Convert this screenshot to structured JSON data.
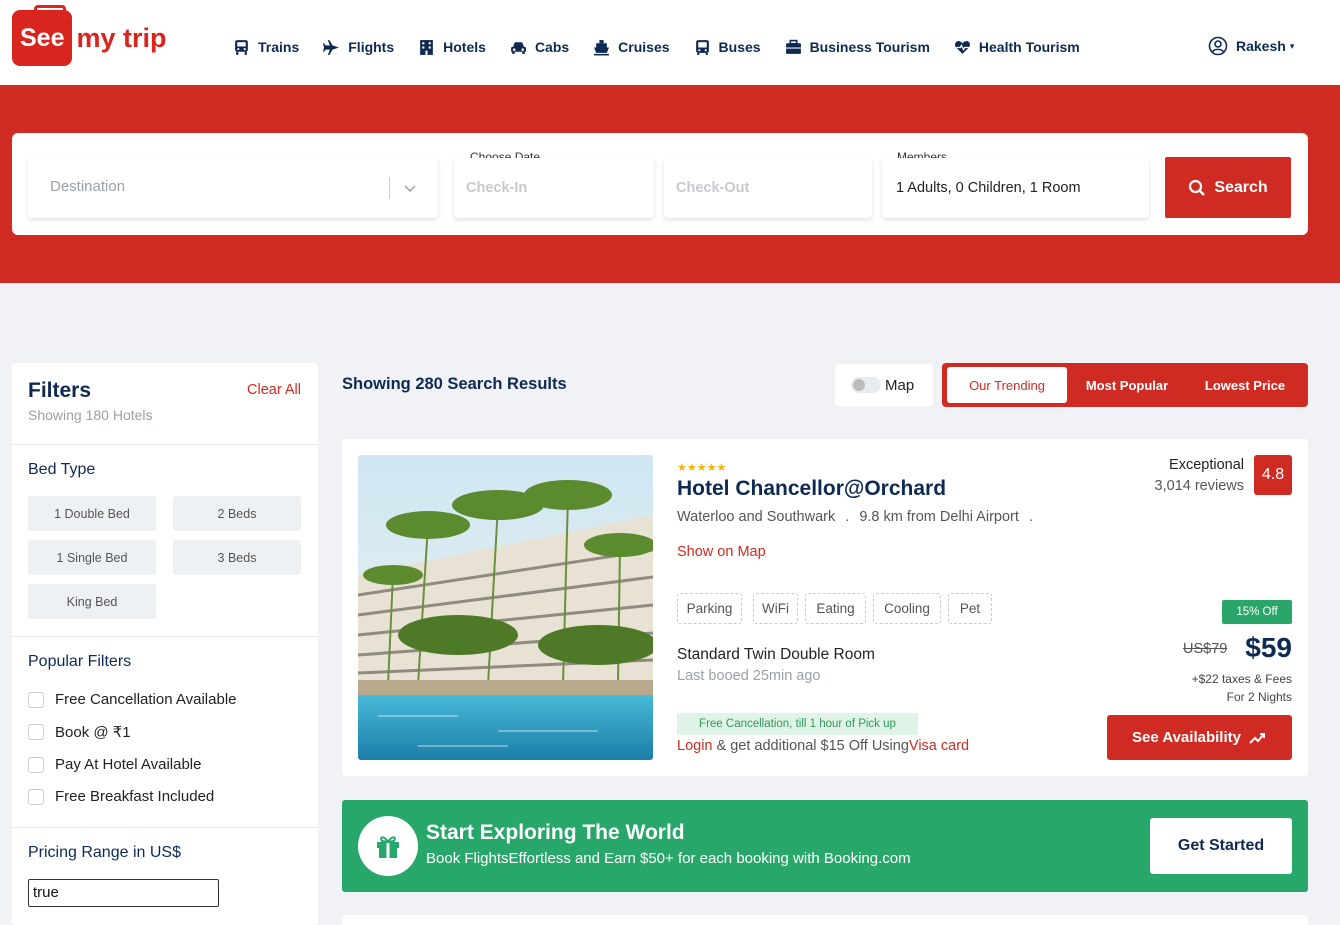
{
  "brand": {
    "logo_box": "See",
    "logo_rest": "my trip",
    "red": "#d02b23",
    "navy": "#0f2a52",
    "green": "#27a86a"
  },
  "nav": [
    {
      "label": "Trains",
      "icon": "train-icon"
    },
    {
      "label": "Flights",
      "icon": "plane-icon"
    },
    {
      "label": "Hotels",
      "icon": "hotel-icon"
    },
    {
      "label": "Cabs",
      "icon": "car-icon"
    },
    {
      "label": "Cruises",
      "icon": "ship-icon"
    },
    {
      "label": "Buses",
      "icon": "bus-icon"
    },
    {
      "label": "Business Tourism",
      "icon": "briefcase-icon"
    },
    {
      "label": "Health Tourism",
      "icon": "heart-pulse-icon"
    }
  ],
  "user": {
    "name": "Rakesh"
  },
  "search": {
    "destination_placeholder": "Destination",
    "date_label": "Choose Date",
    "checkin_placeholder": "Check-In",
    "checkout_placeholder": "Check-Out",
    "members_label": "Members",
    "members_value": "1 Adults, 0 Children, 1 Room",
    "button": "Search"
  },
  "filters": {
    "title": "Filters",
    "subtitle": "Showing 180 Hotels",
    "clear": "Clear All",
    "bed_type_title": "Bed Type",
    "beds": [
      "1 Double Bed",
      "2 Beds",
      "1 Single Bed",
      "3 Beds",
      "King Bed"
    ],
    "popular_title": "Popular Filters",
    "popular": [
      "Free Cancellation Available",
      "Book @ ₹1",
      "Pay At Hotel Available",
      "Free Breakfast Included"
    ],
    "pricing_title": "Pricing Range in US$",
    "pricing_value": "true"
  },
  "results": {
    "title": "Showing 280 Search Results",
    "map_label": "Map",
    "sort": [
      "Our Trending",
      "Most Popular",
      "Lowest Price"
    ]
  },
  "hotel": {
    "stars": "★★★★★",
    "name": "Hotel Chancellor@Orchard",
    "area": "Waterloo and Southwark",
    "distance": "9.8 km from Delhi Airport",
    "show_map": "Show on Map",
    "amenities": [
      "Parking",
      "WiFi",
      "Eating",
      "Cooling",
      "Pet"
    ],
    "room": "Standard Twin Double Room",
    "booked": "Last booed 25min ago",
    "free_cancel": "Free Cancellation, till 1 hour of Pick up",
    "login": "Login",
    "login_mid": " & get additional $15 Off Using",
    "login_card": "Visa card",
    "rating_label": "Exceptional",
    "reviews": "3,014 reviews",
    "rating": "4.8",
    "discount": "15% Off",
    "old_price": "US$79",
    "price": "$59",
    "taxes": "+$22 taxes & Fees",
    "nights": "For 2 Nights",
    "cta": "See Availability"
  },
  "promo": {
    "title": "Start Exploring The World",
    "subtitle": "Book FlightsEffortless and Earn $50+ for each booking with Booking.com",
    "button": "Get Started"
  }
}
